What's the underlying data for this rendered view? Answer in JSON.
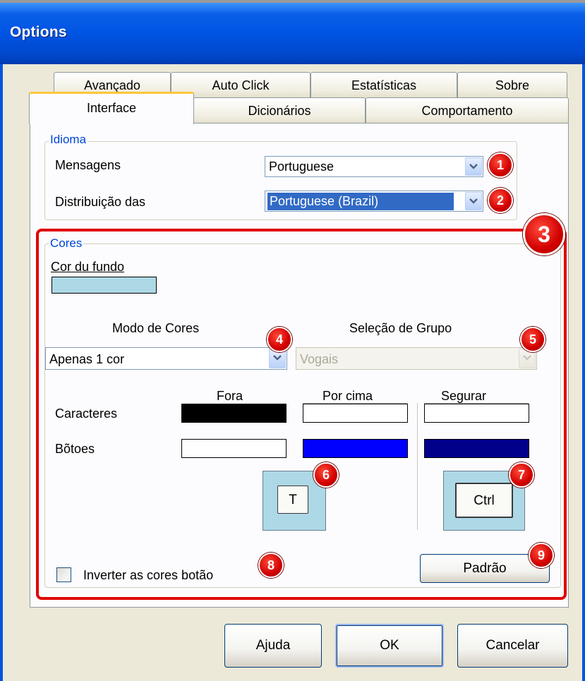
{
  "window": {
    "title": "Options"
  },
  "tabs": {
    "back_row": [
      "Avançado",
      "Auto Click",
      "Estatísticas",
      "Sobre"
    ],
    "front_row": [
      "Interface",
      "Dicionários",
      "Comportamento"
    ],
    "active": "Interface"
  },
  "idioma": {
    "legend": "Idioma",
    "mensagens_label": "Mensagens",
    "mensagens_value": "Portuguese",
    "distribuicao_label": "Distribuição das",
    "distribuicao_value": "Portuguese (Brazil)"
  },
  "cores": {
    "legend": "Cores",
    "cor_fundo_label": "Cor du fundo",
    "cor_fundo_color": "#add8e6",
    "modo_label": "Modo de Cores",
    "modo_value": "Apenas 1 cor",
    "selecao_label": "Seleção de Grupo",
    "selecao_value": "Vogais",
    "col_fora": "Fora",
    "col_por_cima": "Por cima",
    "col_segurar": "Segurar",
    "row_caracteres": "Caracteres",
    "row_botoes": "Bõtoes",
    "colors": {
      "caracteres_fora": "#000000",
      "caracteres_por_cima": "#ffffff",
      "caracteres_segurar": "#ffffff",
      "botoes_fora": "#ffffff",
      "botoes_por_cima": "#0000ff",
      "botoes_segurar": "#00008b"
    },
    "preview_t_label": "T",
    "preview_ctrl_label": "Ctrl",
    "invert_label": "Inverter as cores botão",
    "invert_checked": false,
    "padrao_label": "Padrão"
  },
  "footer": {
    "ajuda": "Ajuda",
    "ok": "OK",
    "cancelar": "Cancelar"
  },
  "annotations": [
    "1",
    "2",
    "3",
    "4",
    "5",
    "6",
    "7",
    "8",
    "9"
  ],
  "annotation_color": "#e00000"
}
